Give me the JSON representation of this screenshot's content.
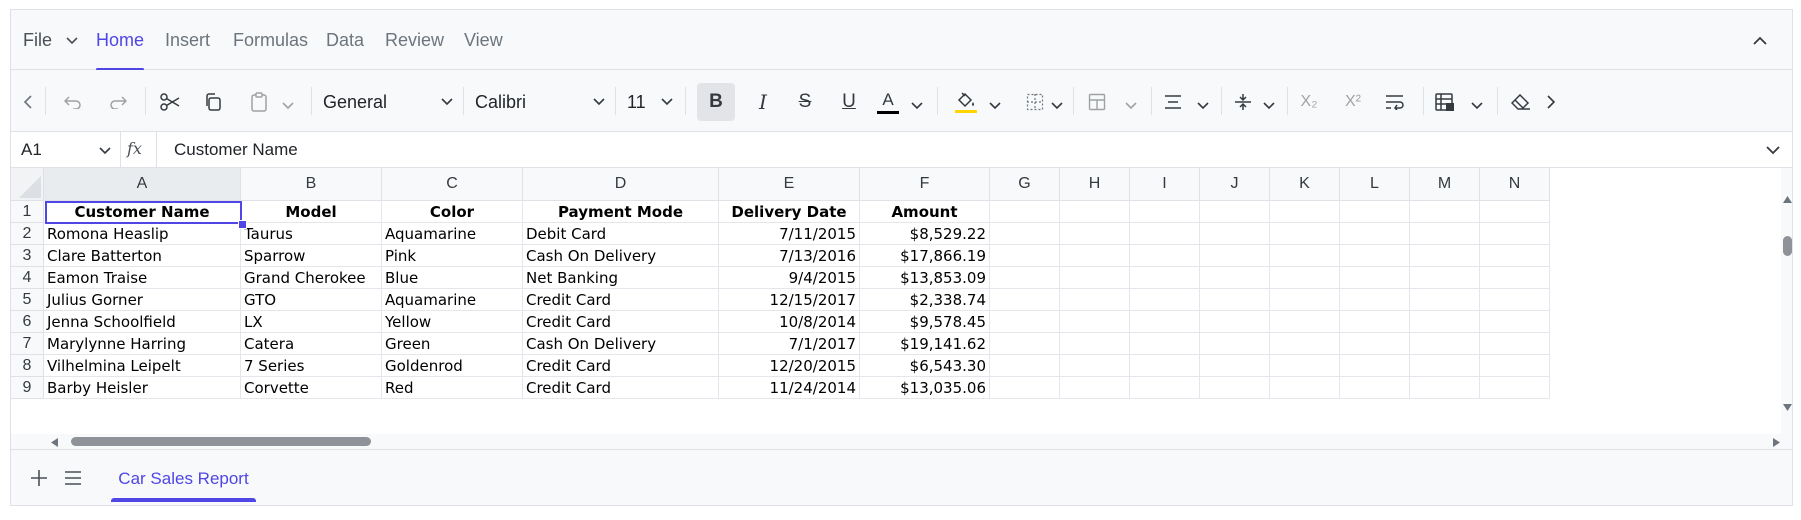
{
  "ribbon": {
    "tabs": [
      {
        "label": "File"
      },
      {
        "label": "Home"
      },
      {
        "label": "Insert"
      },
      {
        "label": "Formulas"
      },
      {
        "label": "Data"
      },
      {
        "label": "Review"
      },
      {
        "label": "View"
      }
    ],
    "active_tab": "Home"
  },
  "toolbar": {
    "number_format": "General",
    "font_name": "Calibri",
    "font_size": "11",
    "font_color": "#000000",
    "fill_color": "#ffd400"
  },
  "formula_bar": {
    "name_box": "A1",
    "fx_label": "fx",
    "value": "Customer Name"
  },
  "grid": {
    "columns": [
      "A",
      "B",
      "C",
      "D",
      "E",
      "F",
      "G",
      "H",
      "I",
      "J",
      "K",
      "L",
      "M",
      "N"
    ],
    "row_numbers": [
      "1",
      "2",
      "3",
      "4",
      "5",
      "6",
      "7",
      "8",
      "9"
    ],
    "header_row": [
      "Customer Name",
      "Model",
      "Color",
      "Payment Mode",
      "Delivery Date",
      "Amount"
    ],
    "rows": [
      [
        "Romona Heaslip",
        "Taurus",
        "Aquamarine",
        "Debit Card",
        "7/11/2015",
        "$8,529.22"
      ],
      [
        "Clare Batterton",
        "Sparrow",
        "Pink",
        "Cash On Delivery",
        "7/13/2016",
        "$17,866.19"
      ],
      [
        "Eamon Traise",
        "Grand Cherokee",
        "Blue",
        "Net Banking",
        "9/4/2015",
        "$13,853.09"
      ],
      [
        "Julius Gorner",
        "GTO",
        "Aquamarine",
        "Credit Card",
        "12/15/2017",
        "$2,338.74"
      ],
      [
        "Jenna Schoolfield",
        "LX",
        "Yellow",
        "Credit Card",
        "10/8/2014",
        "$9,578.45"
      ],
      [
        "Marylynne Harring",
        "Catera",
        "Green",
        "Cash On Delivery",
        "7/1/2017",
        "$19,141.62"
      ],
      [
        "Vilhelmina Leipelt",
        "7 Series",
        "Goldenrod",
        "Credit Card",
        "12/20/2015",
        "$6,543.30"
      ],
      [
        "Barby Heisler",
        "Corvette",
        "Red",
        "Credit Card",
        "11/24/2014",
        "$13,035.06"
      ]
    ],
    "selected_cell": "A1"
  },
  "sheets": {
    "tabs": [
      {
        "label": "Car Sales Report"
      }
    ],
    "active": "Car Sales Report"
  },
  "colors": {
    "accent": "#4f46e5"
  }
}
